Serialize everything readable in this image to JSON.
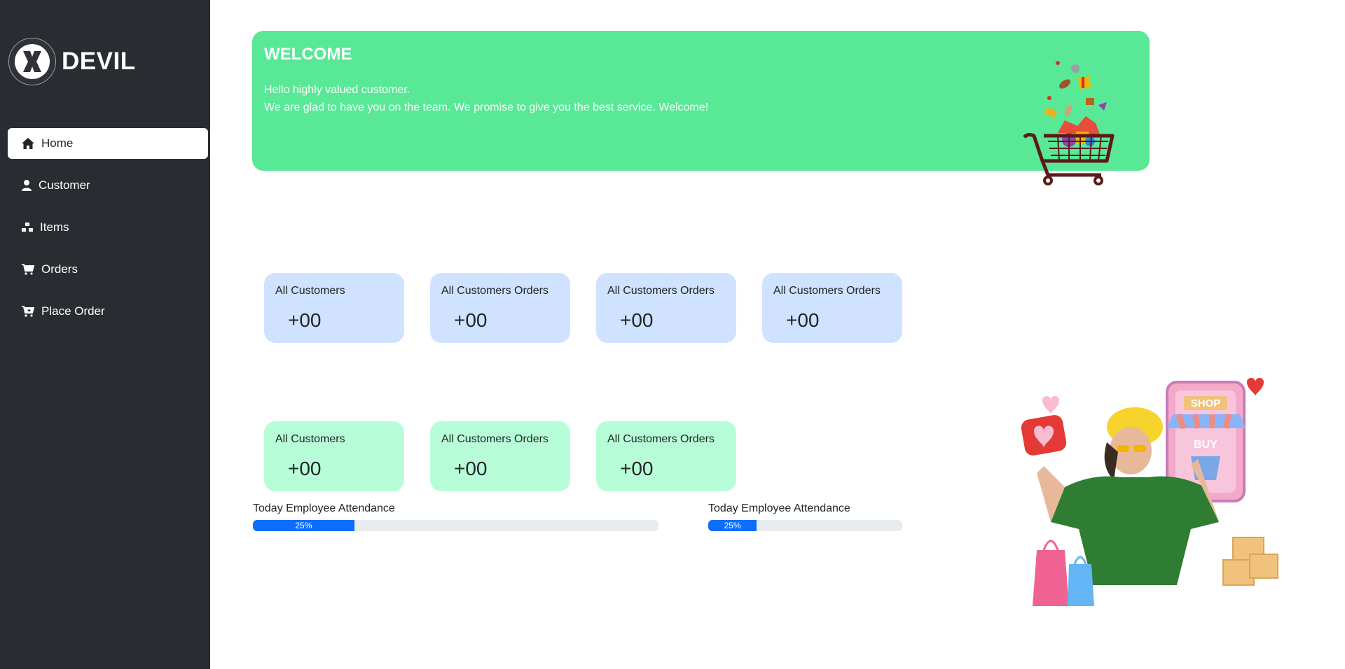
{
  "brand": {
    "name": "DEVIL",
    "logo_icon": "x-logo-icon"
  },
  "sidebar": {
    "items": [
      {
        "label": "Home",
        "icon": "home-icon",
        "active": true
      },
      {
        "label": "Customer",
        "icon": "user-icon",
        "active": false
      },
      {
        "label": "Items",
        "icon": "boxes-icon",
        "active": false
      },
      {
        "label": "Orders",
        "icon": "cart-icon",
        "active": false
      },
      {
        "label": "Place Order",
        "icon": "cart-plus-icon",
        "active": false
      }
    ]
  },
  "welcome": {
    "title": "WELCOME",
    "line1": "Hello highly valued customer.",
    "line2": "We are glad to have you on the team. We promise to give you the best service. Welcome!"
  },
  "stats_row1": [
    {
      "label": "All Customers",
      "value": "+00"
    },
    {
      "label": "All Customers Orders",
      "value": "+00"
    },
    {
      "label": "All Customers Orders",
      "value": "+00"
    },
    {
      "label": "All Customers Orders",
      "value": "+00"
    }
  ],
  "stats_row2": [
    {
      "label": "All Customers",
      "value": "+00"
    },
    {
      "label": "All Customers Orders",
      "value": "+00"
    },
    {
      "label": "All Customers Orders",
      "value": "+00"
    }
  ],
  "attendance": [
    {
      "label": "Today Employee Attendance",
      "percent": 25,
      "text": "25%"
    },
    {
      "label": "Today Employee Attendance",
      "percent": 25,
      "text": "25%"
    }
  ],
  "colors": {
    "sidebar": "#292d31",
    "welcome_bg": "#58e896",
    "card_blue": "#cfe2ff",
    "card_green": "#b6fdd8",
    "progress": "#0d6efd"
  }
}
